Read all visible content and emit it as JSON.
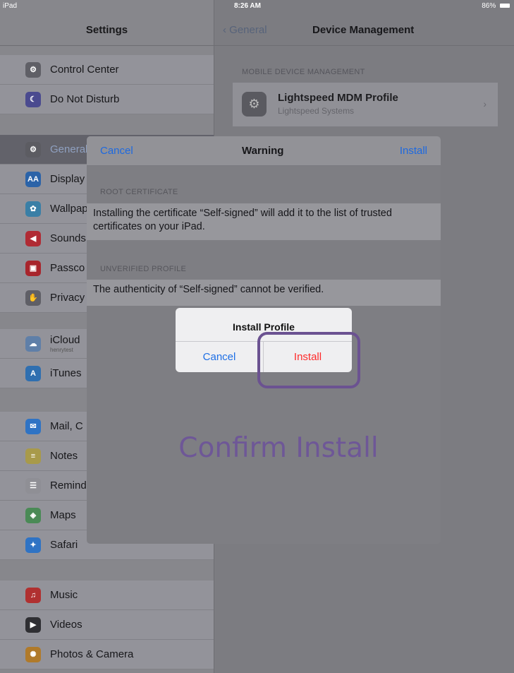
{
  "status_bar": {
    "device": "iPad",
    "time": "8:26 AM",
    "battery": "86%"
  },
  "sidebar": {
    "title": "Settings",
    "groups": [
      {
        "items": [
          {
            "label": "Control Center",
            "icon": "control-center-icon",
            "color": "#5f5f66"
          },
          {
            "label": "Do Not Disturb",
            "icon": "moon-icon",
            "color": "#4a4a8f"
          }
        ]
      },
      {
        "items": [
          {
            "label": "General",
            "icon": "gear-icon",
            "color": "#5c5c62",
            "selected": true
          },
          {
            "label": "Display",
            "icon": "text-size-icon",
            "color": "#2b63a8"
          },
          {
            "label": "Wallpap",
            "icon": "wallpaper-icon",
            "color": "#3a7fa6"
          },
          {
            "label": "Sounds",
            "icon": "speaker-icon",
            "color": "#b02b34"
          },
          {
            "label": "Passco",
            "icon": "lock-icon",
            "color": "#a8252c"
          },
          {
            "label": "Privacy",
            "icon": "hand-icon",
            "color": "#5f5f66"
          }
        ]
      },
      {
        "items": [
          {
            "label": "iCloud",
            "sub": "henrytest",
            "icon": "cloud-icon",
            "color": "#5f7fa8"
          },
          {
            "label": "iTunes",
            "icon": "app-store-icon",
            "color": "#2f6fb0"
          }
        ]
      },
      {
        "items": [
          {
            "label": "Mail, C",
            "icon": "mail-icon",
            "color": "#2f73c4"
          },
          {
            "label": "Notes",
            "icon": "notes-icon",
            "color": "#a89a4a"
          },
          {
            "label": "Remind",
            "icon": "reminders-icon",
            "color": "#8f8f95"
          },
          {
            "label": "Maps",
            "icon": "maps-icon",
            "color": "#4a8a56"
          },
          {
            "label": "Safari",
            "icon": "compass-icon",
            "color": "#2f73c4"
          }
        ]
      },
      {
        "items": [
          {
            "label": "Music",
            "icon": "music-icon",
            "color": "#b03030"
          },
          {
            "label": "Videos",
            "icon": "videos-icon",
            "color": "#2f2f33"
          },
          {
            "label": "Photos & Camera",
            "icon": "photos-icon",
            "color": "#b07a2a"
          }
        ]
      }
    ]
  },
  "detail": {
    "back_label": "General",
    "title": "Device Management",
    "section_header": "MOBILE DEVICE MANAGEMENT",
    "profile": {
      "name": "Lightspeed MDM Profile",
      "org": "Lightspeed Systems"
    }
  },
  "warning_sheet": {
    "cancel_label": "Cancel",
    "title": "Warning",
    "install_label": "Install",
    "sections": [
      {
        "header": "ROOT CERTIFICATE",
        "body": "Installing the certificate “Self-signed” will add it to the list of trusted certificates on your iPad."
      },
      {
        "header": "UNVERIFIED PROFILE",
        "body": "The authenticity of “Self-signed” cannot be verified."
      }
    ]
  },
  "alert": {
    "title": "Install Profile",
    "cancel_label": "Cancel",
    "install_label": "Install"
  },
  "annotation": {
    "text": "Confirm Install",
    "color": "#6e5797"
  }
}
